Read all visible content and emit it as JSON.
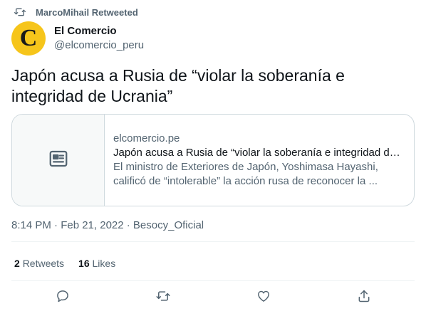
{
  "retweet_context": {
    "text": "MarcoMihail Retweeted",
    "icon": "retweet-icon"
  },
  "author": {
    "avatar_letter": "C",
    "avatar_color": "#f6c51b",
    "display_name": "El Comercio",
    "handle": "@elcomercio_peru"
  },
  "tweet": {
    "text": "Japón acusa a Rusia de “violar la soberanía e integridad de Ucrania”"
  },
  "card": {
    "thumbnail_icon": "article-icon",
    "domain": "elcomercio.pe",
    "title": "Japón acusa a Rusia de “violar la soberanía e integridad de ...",
    "description": "El ministro de Exteriores de Japón, Yoshimasa Hayashi, calificó de “intolerable” la acción rusa de reconocer la ..."
  },
  "meta": {
    "text": "8:14 PM · Feb 21, 2022 · Besocy_Oficial"
  },
  "stats": {
    "retweets_count": "2",
    "retweets_label": "Retweets",
    "likes_count": "16",
    "likes_label": "Likes"
  },
  "actions": [
    "reply-icon",
    "retweet-icon",
    "like-icon",
    "share-icon"
  ],
  "colors": {
    "text_primary": "#0f1419",
    "text_secondary": "#536471",
    "border": "#cfd9de",
    "divider": "#eff3f4"
  }
}
